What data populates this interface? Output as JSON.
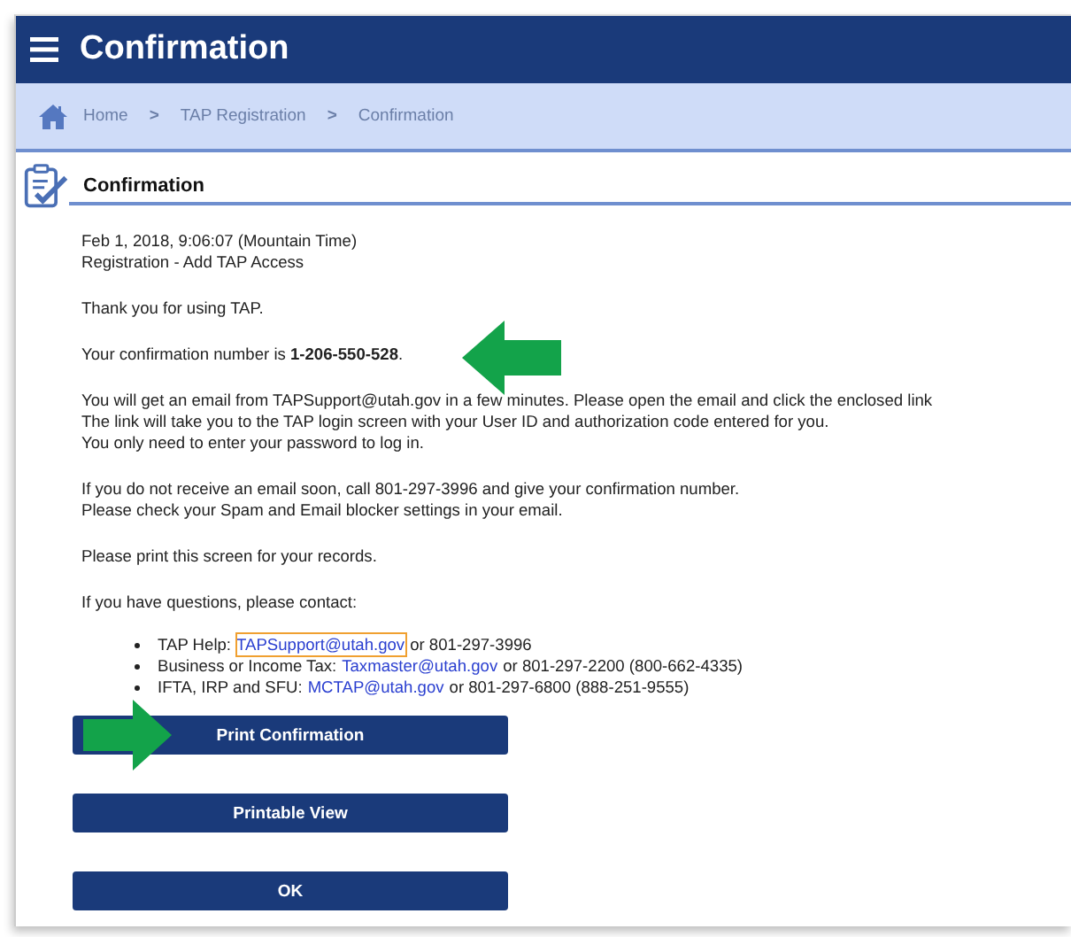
{
  "header": {
    "title": "Confirmation"
  },
  "breadcrumb": {
    "separator": ">",
    "items": [
      {
        "label": "Home",
        "kind": "home"
      },
      {
        "label": "TAP Registration",
        "kind": "link"
      },
      {
        "label": "Confirmation",
        "kind": "link"
      }
    ]
  },
  "section_title": "Confirmation",
  "meta": [
    "Feb 1, 2018, 9:06:07 (Mountain Time)",
    "Registration - Add TAP Access"
  ],
  "paragraphs": [
    [
      "Thank you for using TAP."
    ],
    [
      "Your confirmation number is **1-206-550-528**."
    ],
    [
      "You will get an email from TAPSupport@utah.gov in a few minutes. Please open the email and click the enclosed link",
      "The link will take you to the TAP login screen with your User ID and authorization code entered for you.",
      "You only need to enter your password to log in."
    ],
    [
      "If you do not receive an email soon, call 801-297-3996 and give your confirmation number.",
      "Please check your Spam and Email blocker settings in your email."
    ],
    [
      "Please print this screen for your records."
    ],
    [
      "If you have questions, please contact:"
    ]
  ],
  "contacts": [
    {
      "label": "TAP Help:",
      "email": "TAPSupport@utah.gov",
      "focused": true,
      "phone": "or 801-297-3996"
    },
    {
      "label": "Business or Income Tax:",
      "email": "Taxmaster@utah.gov",
      "focused": false,
      "phone": "or 801-297-2200 (800-662-4335)"
    },
    {
      "label": "IFTA, IRP and SFU:",
      "email": "MCTAP@utah.gov",
      "focused": false,
      "phone": "or 801-297-6800 (888-251-9555)"
    }
  ],
  "buttons": [
    "Print Confirmation",
    "Printable View",
    "OK"
  ]
}
